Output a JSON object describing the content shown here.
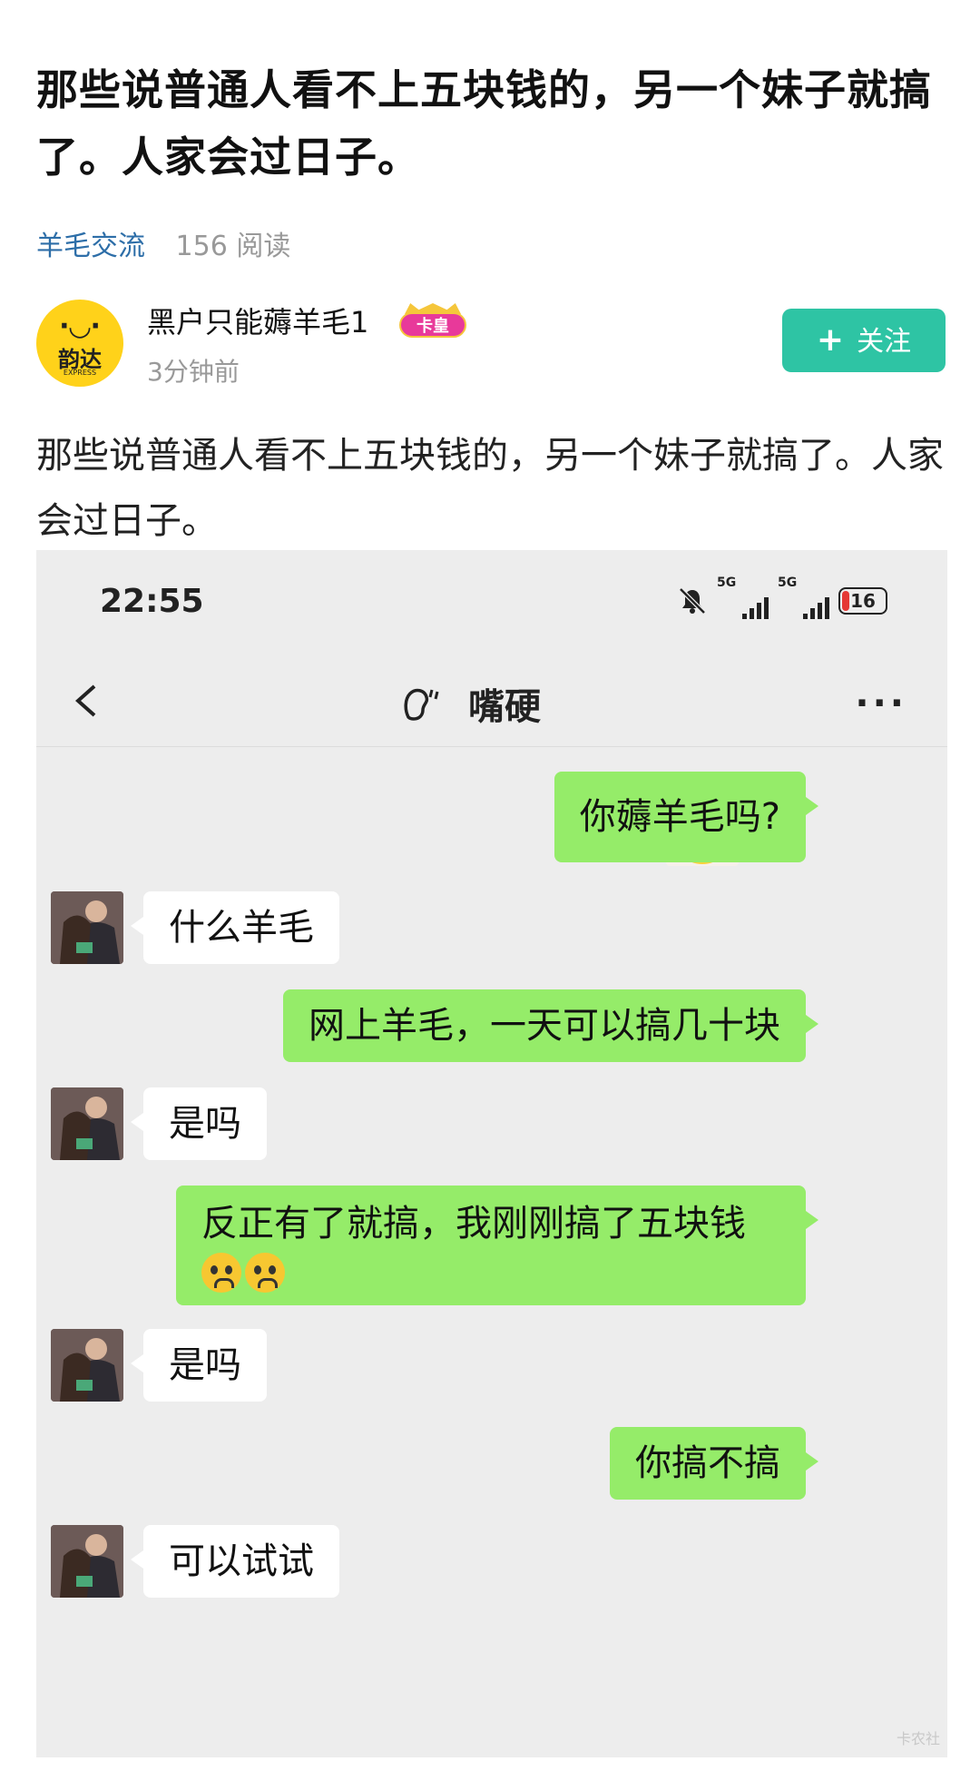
{
  "post": {
    "title": "那些说普通人看不上五块钱的，另一个妹子就搞了。人家会过日子。",
    "category": "羊毛交流",
    "reads": "156 阅读",
    "body": "那些说普通人看不上五块钱的，另一个妹子就搞了。人家会过日子。"
  },
  "author": {
    "name": "黑户只能薅羊毛1",
    "badge": "卡皇",
    "time": "3分钟前",
    "avatar_text": "韵达",
    "avatar_sub": "EXPRESS",
    "follow_label": "关注"
  },
  "screenshot": {
    "status": {
      "time": "22:55",
      "net1": "5G",
      "net2": "5G",
      "battery": "16"
    },
    "chat_title": "嘴硬",
    "more": "···",
    "messages": [
      {
        "side": "out",
        "text": "你薅羊毛吗?"
      },
      {
        "side": "in",
        "text": "什么羊毛"
      },
      {
        "side": "out",
        "text": "网上羊毛，一天可以搞几十块"
      },
      {
        "side": "in",
        "text": "是吗"
      },
      {
        "side": "out",
        "text": "反正有了就搞，我刚刚搞了五块钱"
      },
      {
        "side": "in",
        "text": "是吗"
      },
      {
        "side": "out",
        "text": "你搞不搞"
      },
      {
        "side": "in",
        "text": "可以试试"
      }
    ],
    "watermark": "卡农社"
  },
  "colors": {
    "accent": "#2ec4a4",
    "bubble_out": "#95ec69",
    "category_link": "#2d6ea8"
  },
  "icons": [
    "back-icon",
    "ear-icon",
    "more-icon",
    "mute-icon",
    "signal-icon",
    "battery-icon",
    "plus-icon",
    "crying-emoji-icon"
  ]
}
